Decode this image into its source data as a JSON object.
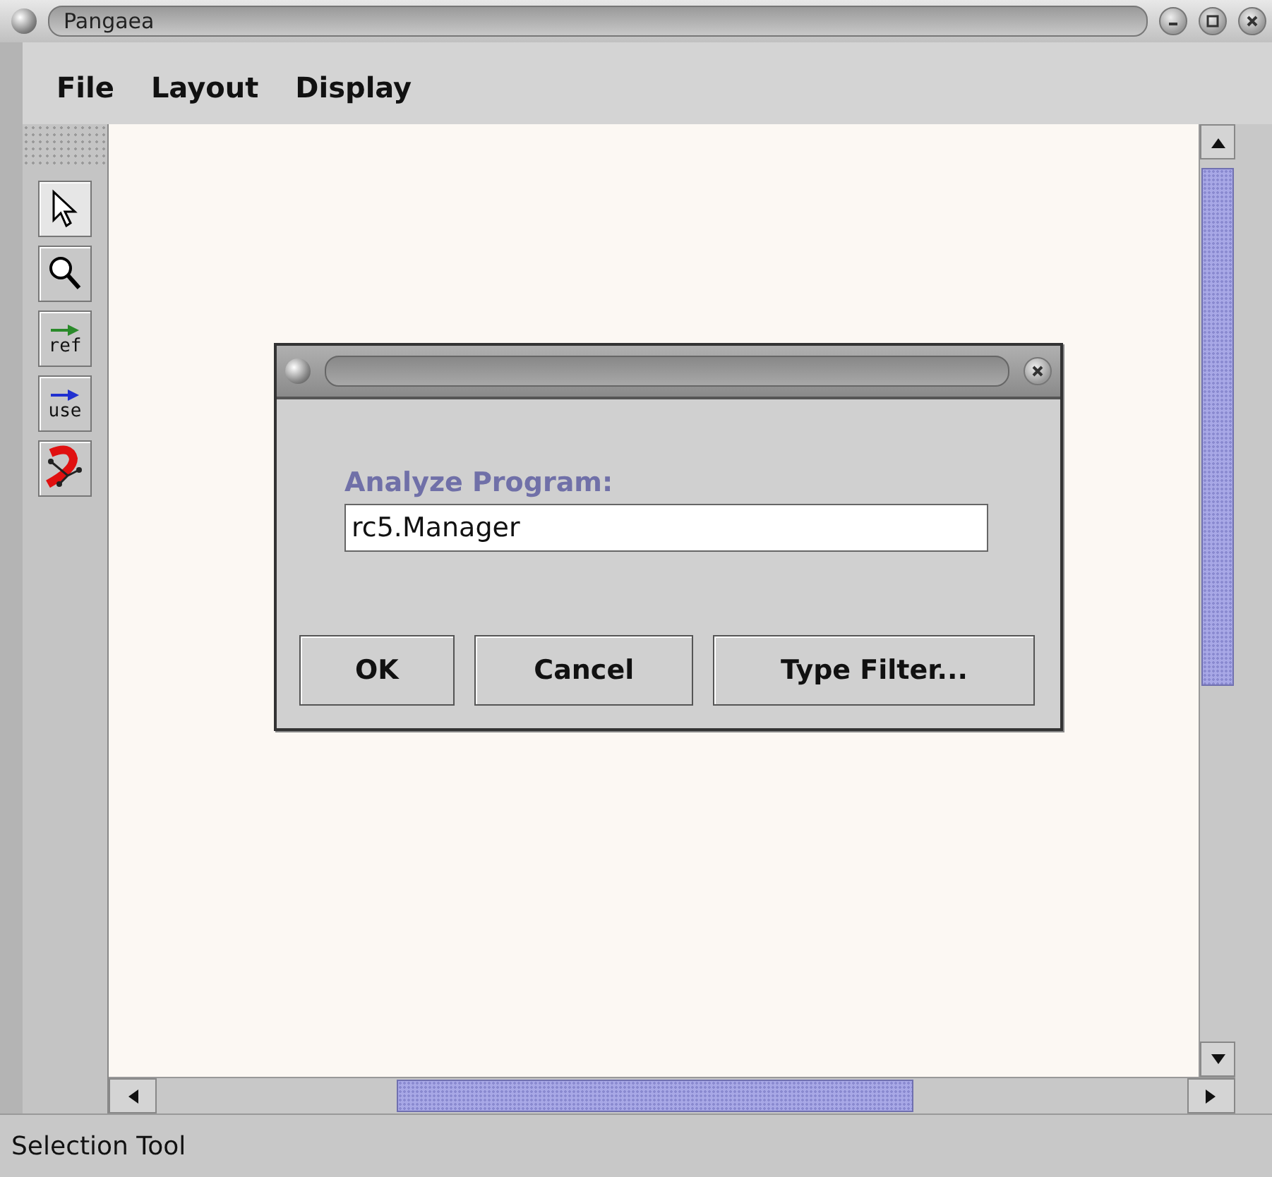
{
  "window": {
    "title": "Pangaea"
  },
  "menu": [
    "File",
    "Layout",
    "Display"
  ],
  "tools": [
    {
      "kind": "pointer",
      "selected": true
    },
    {
      "kind": "zoom",
      "selected": false
    },
    {
      "kind": "ref",
      "label": "ref",
      "selected": false
    },
    {
      "kind": "use",
      "label": "use",
      "selected": false
    },
    {
      "kind": "graph",
      "selected": false
    }
  ],
  "dialog": {
    "label": "Analyze Program:",
    "value": "rc5.Manager",
    "buttons": [
      "OK",
      "Cancel",
      "Type Filter..."
    ]
  },
  "status_bar": "Selection Tool"
}
